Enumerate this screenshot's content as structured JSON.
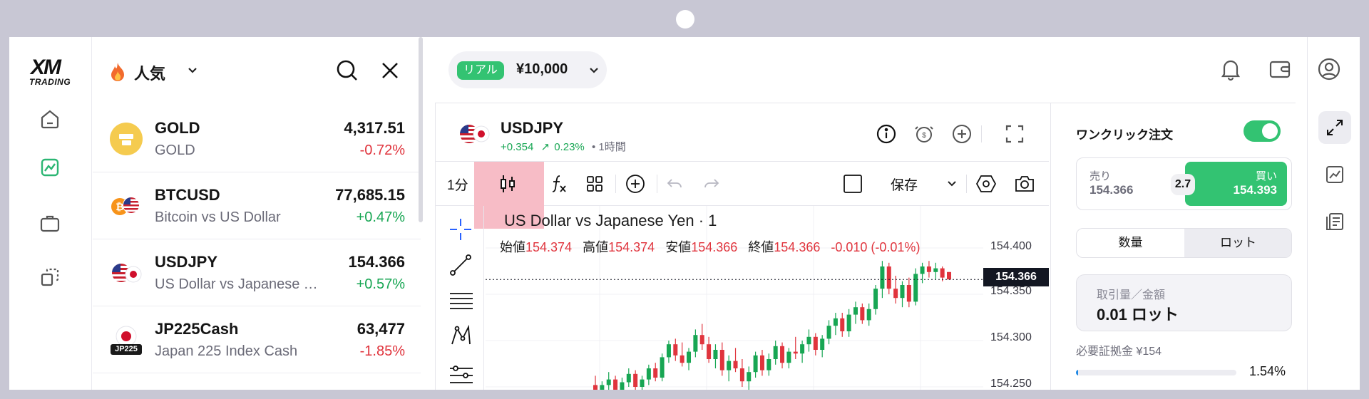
{
  "account": {
    "mode_badge": "リアル",
    "balance": "¥10,000"
  },
  "watchlist": {
    "category": "人気",
    "rows": [
      {
        "symbol": "GOLD",
        "description": "GOLD",
        "price": "4,317.51",
        "change": "-0.72%",
        "direction": "down"
      },
      {
        "symbol": "BTCUSD",
        "description": "Bitcoin vs US Dollar",
        "price": "77,685.15",
        "change": "+0.47%",
        "direction": "up"
      },
      {
        "symbol": "USDJPY",
        "description": "US Dollar vs Japanese Yen",
        "price": "154.366",
        "change": "+0.57%",
        "direction": "up"
      },
      {
        "symbol": "JP225Cash",
        "description": "Japan 225 Index Cash",
        "price": "63,477",
        "change": "-1.85%",
        "direction": "down",
        "badge": "JP225"
      }
    ]
  },
  "chart_header": {
    "symbol": "USDJPY",
    "change_abs": "+0.354",
    "change_pct": "0.23%",
    "timeframe_label": "• 1時間"
  },
  "toolbar": {
    "interval": "1分",
    "save_label": "保存"
  },
  "chart": {
    "title": "US Dollar vs Japanese Yen · 1",
    "ohlc": [
      {
        "label": "始値",
        "value": "154.374"
      },
      {
        "label": "高値",
        "value": "154.374"
      },
      {
        "label": "安値",
        "value": "154.366"
      },
      {
        "label": "終値",
        "value": "154.366"
      }
    ],
    "change_text": "-0.010 (-0.01%)",
    "last_price_tag": "154.366",
    "y_ticks": [
      "154.400",
      "154.350",
      "154.300",
      "154.250"
    ]
  },
  "chart_data": {
    "type": "candlestick",
    "title": "US Dollar vs Japanese Yen · 1",
    "ylim": [
      154.24,
      154.41
    ],
    "y_ticks": [
      154.4,
      154.35,
      154.3,
      154.25
    ],
    "last_price": 154.366,
    "candles": [
      [
        154.252,
        154.262,
        154.24,
        154.246
      ],
      [
        154.246,
        154.256,
        154.238,
        154.252
      ],
      [
        154.252,
        154.266,
        154.246,
        154.258
      ],
      [
        154.258,
        154.262,
        154.24,
        154.244
      ],
      [
        154.244,
        154.26,
        154.238,
        154.255
      ],
      [
        154.255,
        154.27,
        154.25,
        154.264
      ],
      [
        154.264,
        154.268,
        154.245,
        154.25
      ],
      [
        154.25,
        154.262,
        154.244,
        154.258
      ],
      [
        154.258,
        154.274,
        154.252,
        154.27
      ],
      [
        154.27,
        154.276,
        154.256,
        154.26
      ],
      [
        154.26,
        154.286,
        154.256,
        154.282
      ],
      [
        154.282,
        154.3,
        154.276,
        154.296
      ],
      [
        154.296,
        154.302,
        154.278,
        154.284
      ],
      [
        154.284,
        154.298,
        154.272,
        154.276
      ],
      [
        154.276,
        154.292,
        154.268,
        154.288
      ],
      [
        154.288,
        154.312,
        154.282,
        154.306
      ],
      [
        154.306,
        154.318,
        154.29,
        154.296
      ],
      [
        154.296,
        154.304,
        154.276,
        154.28
      ],
      [
        154.28,
        154.296,
        154.27,
        154.29
      ],
      [
        154.29,
        154.298,
        154.262,
        154.268
      ],
      [
        154.268,
        154.284,
        154.256,
        154.278
      ],
      [
        154.278,
        154.292,
        154.266,
        154.27
      ],
      [
        154.27,
        154.28,
        154.25,
        154.256
      ],
      [
        154.256,
        154.272,
        154.246,
        154.266
      ],
      [
        154.266,
        154.288,
        154.26,
        154.284
      ],
      [
        154.284,
        154.29,
        154.262,
        154.268
      ],
      [
        154.268,
        154.286,
        154.262,
        154.28
      ],
      [
        154.28,
        154.3,
        154.274,
        154.294
      ],
      [
        154.294,
        154.298,
        154.27,
        154.276
      ],
      [
        154.276,
        154.292,
        154.27,
        154.288
      ],
      [
        154.288,
        154.304,
        154.28,
        154.286
      ],
      [
        154.286,
        154.3,
        154.276,
        154.296
      ],
      [
        154.296,
        154.312,
        154.288,
        154.304
      ],
      [
        154.304,
        154.308,
        154.284,
        154.29
      ],
      [
        154.29,
        154.306,
        154.282,
        154.302
      ],
      [
        154.302,
        154.322,
        154.296,
        154.316
      ],
      [
        154.316,
        154.33,
        154.306,
        154.324
      ],
      [
        154.324,
        154.33,
        154.304,
        154.31
      ],
      [
        154.31,
        154.334,
        154.304,
        154.328
      ],
      [
        154.328,
        154.342,
        154.318,
        154.336
      ],
      [
        154.336,
        154.34,
        154.318,
        154.322
      ],
      [
        154.322,
        154.34,
        154.316,
        154.334
      ],
      [
        154.334,
        154.36,
        154.328,
        154.356
      ],
      [
        154.356,
        154.386,
        154.346,
        154.38
      ],
      [
        154.38,
        154.384,
        154.35,
        154.356
      ],
      [
        154.356,
        154.37,
        154.34,
        154.346
      ],
      [
        154.346,
        154.364,
        154.336,
        154.36
      ],
      [
        154.36,
        154.368,
        154.336,
        154.342
      ],
      [
        154.342,
        154.378,
        154.338,
        154.372
      ],
      [
        154.372,
        154.384,
        154.362,
        154.38
      ],
      [
        154.38,
        154.386,
        154.368,
        154.374
      ],
      [
        154.374,
        154.384,
        154.366,
        154.378
      ],
      [
        154.378,
        154.38,
        154.364,
        154.368
      ],
      [
        154.374,
        154.374,
        154.366,
        154.366
      ]
    ]
  },
  "order_panel": {
    "one_click_label": "ワンクリック注文",
    "one_click_on": true,
    "sell_label": "売り",
    "sell_price": "154.366",
    "spread": "2.7",
    "buy_label": "買い",
    "buy_price": "154.393",
    "seg_quantity": "数量",
    "seg_lot": "ロット",
    "volume_label": "取引量／金額",
    "volume_value": "0.01 ロット",
    "margin_text": "必要証拠金 ¥154",
    "margin_level_pct": 1.54,
    "margin_level_text": "1.54%"
  },
  "colors": {
    "green": "#33c372",
    "red": "#e0343d",
    "blue": "#1e88e5",
    "highlight": "#f7bcc6"
  }
}
